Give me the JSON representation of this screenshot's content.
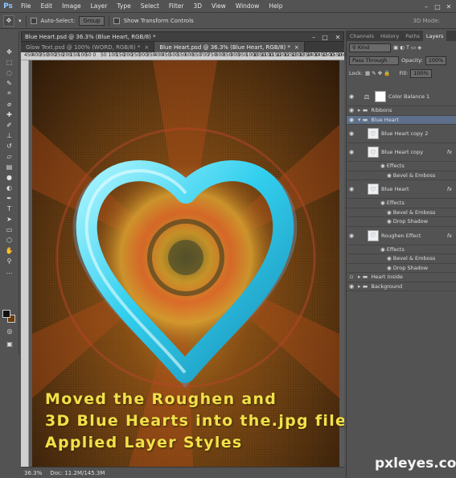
{
  "app": {
    "logo": "Ps"
  },
  "menu": [
    "File",
    "Edit",
    "Image",
    "Layer",
    "Type",
    "Select",
    "Filter",
    "3D",
    "View",
    "Window",
    "Help"
  ],
  "options": {
    "auto_select_label": "Auto-Select:",
    "auto_select_value": "Group",
    "transform_label": "Show Transform Controls",
    "mode_3d": "3D Mode:"
  },
  "document": {
    "float_title": "Blue Heart.psd @ 36.3% (Blue Heart, RGB/8) *",
    "tabs": [
      {
        "label": "Glow Text.psd @ 100% (WORD, RGB/8) *",
        "close": "×"
      },
      {
        "label": "Blue Heart.psd @ 36.3% (Blue Heart, RGB/8) *",
        "close": "×"
      }
    ],
    "ruler_numbers": [
      "450",
      "400",
      "350",
      "300",
      "250",
      "200",
      "150",
      "100",
      "50",
      "0",
      "50",
      "100",
      "150",
      "200",
      "250",
      "300",
      "350",
      "400",
      "450",
      "500",
      "550",
      "600",
      "650",
      "700",
      "750",
      "800",
      "850",
      "900",
      "950",
      "1000",
      "1050",
      "1100",
      "1150",
      "1200",
      "1250",
      "1300",
      "1350",
      "1400",
      "1450",
      "1500",
      "1550",
      "1600"
    ],
    "caption_lines": [
      "Moved the Roughen and",
      "3D Blue Hearts into the.jpg file,",
      "Applied Layer Styles"
    ]
  },
  "status": {
    "zoom": "36.3%",
    "doc": "Doc: 11.2M/145.3M"
  },
  "panel": {
    "tabs": [
      "Channels",
      "History",
      "Paths",
      "Layers"
    ],
    "kind_label": "Kind",
    "blend_mode": "Pass Through",
    "opacity_label": "Opacity:",
    "opacity_value": "100%",
    "lock_label": "Lock:",
    "fill_label": "Fill:",
    "fill_value": "100%",
    "layers": [
      {
        "name": "Color Balance 1",
        "type": "adjustment"
      },
      {
        "name": "Ribbons",
        "type": "group"
      },
      {
        "name": "Blue Heart",
        "type": "group-open"
      },
      {
        "name": "Blue Heart copy 2",
        "type": "layer"
      },
      {
        "name": "Blue Heart copy",
        "type": "layer",
        "fx": "fx"
      },
      {
        "name": "Effects",
        "type": "effects"
      },
      {
        "name": "Bevel & Emboss",
        "type": "sub"
      },
      {
        "name": "Blue Heart",
        "type": "layer",
        "fx": "fx"
      },
      {
        "name": "Effects",
        "type": "effects"
      },
      {
        "name": "Bevel & Emboss",
        "type": "sub"
      },
      {
        "name": "Drop Shadow",
        "type": "sub"
      },
      {
        "name": "Roughen Effect",
        "type": "layer",
        "fx": "fx"
      },
      {
        "name": "Effects",
        "type": "effects"
      },
      {
        "name": "Bevel & Emboss",
        "type": "sub"
      },
      {
        "name": "Drop Shadow",
        "type": "sub"
      },
      {
        "name": "Heart Inside",
        "type": "group"
      },
      {
        "name": "Background",
        "type": "group"
      }
    ]
  },
  "watermark": "pxleyes.com",
  "colors": {
    "heart": "#38d8f0",
    "caption": "#f2e04a",
    "accent": "#5d6f8a"
  }
}
